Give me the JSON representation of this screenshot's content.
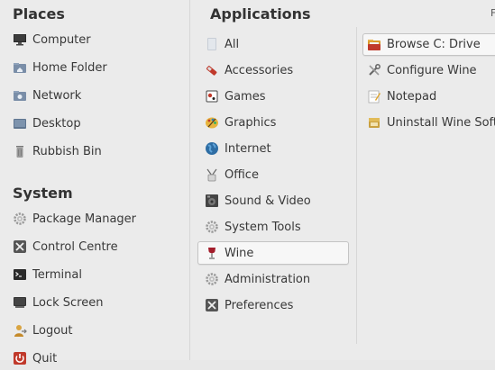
{
  "places": {
    "heading": "Places",
    "items": [
      {
        "label": "Computer",
        "icon": "computer-icon"
      },
      {
        "label": "Home Folder",
        "icon": "home-folder-icon"
      },
      {
        "label": "Network",
        "icon": "network-icon"
      },
      {
        "label": "Desktop",
        "icon": "desktop-icon"
      },
      {
        "label": "Rubbish Bin",
        "icon": "trash-icon"
      }
    ]
  },
  "system": {
    "heading": "System",
    "items": [
      {
        "label": "Package Manager",
        "icon": "gear-icon"
      },
      {
        "label": "Control Centre",
        "icon": "control-centre-icon"
      },
      {
        "label": "Terminal",
        "icon": "terminal-icon"
      },
      {
        "label": "Lock Screen",
        "icon": "lock-screen-icon"
      },
      {
        "label": "Logout",
        "icon": "logout-icon"
      },
      {
        "label": "Quit",
        "icon": "quit-icon"
      }
    ]
  },
  "applications": {
    "heading": "Applications",
    "selected": "Wine",
    "categories": [
      {
        "label": "All",
        "icon": "all-icon"
      },
      {
        "label": "Accessories",
        "icon": "accessories-icon"
      },
      {
        "label": "Games",
        "icon": "games-icon"
      },
      {
        "label": "Graphics",
        "icon": "graphics-icon"
      },
      {
        "label": "Internet",
        "icon": "internet-globe-icon"
      },
      {
        "label": "Office",
        "icon": "office-icon"
      },
      {
        "label": "Sound & Video",
        "icon": "sound-video-icon"
      },
      {
        "label": "System Tools",
        "icon": "system-tools-icon"
      },
      {
        "label": "Wine",
        "icon": "wine-glass-icon"
      },
      {
        "label": "Administration",
        "icon": "administration-icon"
      },
      {
        "label": "Preferences",
        "icon": "preferences-icon"
      }
    ]
  },
  "wine_apps": {
    "selected": "Browse C: Drive",
    "items": [
      {
        "label": "Browse C: Drive",
        "icon": "folder-icon"
      },
      {
        "label": "Configure Wine",
        "icon": "configure-tools-icon"
      },
      {
        "label": "Notepad",
        "icon": "notepad-icon"
      },
      {
        "label": "Uninstall Wine Software",
        "icon": "uninstall-icon"
      }
    ]
  },
  "corner_label": "F",
  "colors": {
    "background": "#ebebeb",
    "selected_bg": "#f7f7f7",
    "selected_border": "#c4c4c4"
  }
}
